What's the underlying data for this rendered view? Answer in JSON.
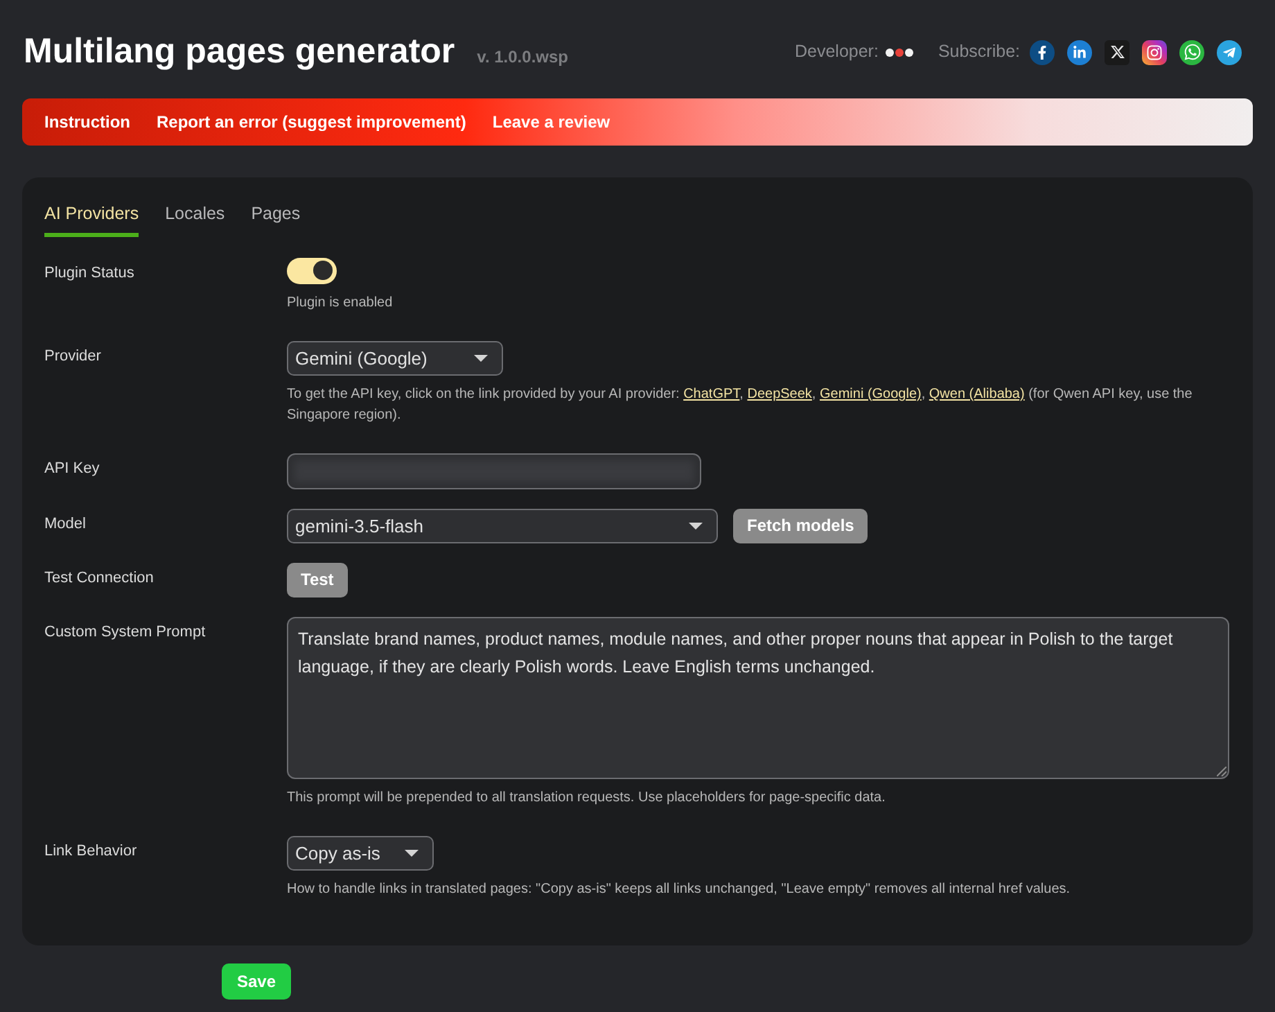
{
  "header": {
    "title": "Multilang pages generator",
    "version": "v. 1.0.0.wsp",
    "developer_label": "Developer:",
    "subscribe_label": "Subscribe:"
  },
  "nav_links": [
    "Instruction",
    "Report an error (suggest improvement)",
    "Leave a review"
  ],
  "tabs": [
    {
      "label": "AI Providers",
      "selected": true
    },
    {
      "label": "Locales",
      "selected": false
    },
    {
      "label": "Pages",
      "selected": false
    }
  ],
  "settings": [
    {
      "kind": "toggle",
      "label": "Plugin Status",
      "on": true,
      "help": "Plugin is enabled"
    },
    {
      "kind": "select",
      "label": "Provider",
      "value": "Gemini (Google)",
      "help_parts": [
        {
          "kind": "text",
          "text": "To get the API key, click on the link provided by your AI provider: "
        },
        {
          "kind": "link",
          "text": "ChatGPT"
        },
        {
          "kind": "text",
          "text": ", "
        },
        {
          "kind": "link",
          "text": "DeepSeek"
        },
        {
          "kind": "text",
          "text": ", "
        },
        {
          "kind": "link",
          "text": "Gemini (Google)"
        },
        {
          "kind": "text",
          "text": ", "
        },
        {
          "kind": "link",
          "text": "Qwen (Alibaba)"
        },
        {
          "kind": "text",
          "text": " (for Qwen API key, use the Singapore region)."
        }
      ]
    },
    {
      "kind": "secret",
      "label": "API Key"
    },
    {
      "kind": "select",
      "label": "Model",
      "value": "gemini-3.5-flash",
      "button": "Fetch models"
    },
    {
      "kind": "button",
      "label": "Test Connection",
      "button": "Test"
    },
    {
      "kind": "textarea",
      "label": "Custom System Prompt",
      "value": "Translate brand names, product names, module names, and other proper nouns that appear in Polish to the target language, if they are clearly Polish words. Leave English terms unchanged.",
      "help": "This prompt will be prepended to all translation requests. Use placeholders for page-specific data."
    },
    {
      "kind": "select",
      "label": "Link Behavior",
      "value": "Copy as-is",
      "help": "How to handle links in translated pages: \"Copy as-is\" keeps all links unchanged, \"Leave empty\" removes all internal href values."
    }
  ],
  "save_button": "Save"
}
